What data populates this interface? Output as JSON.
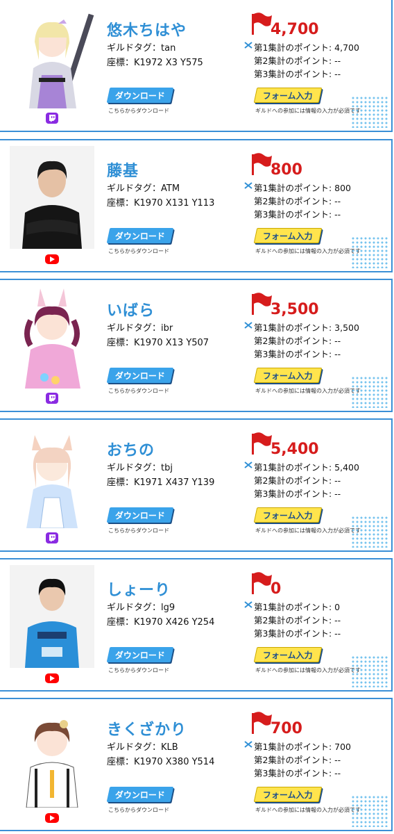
{
  "labels": {
    "download_button": "ダウンロード",
    "download_note": "こちらからダウンロード",
    "form_button": "フォーム入力",
    "form_note": "ギルドへの参加には情報の入力が必須です"
  },
  "colors": {
    "accent_blue": "#2f8fd5",
    "total_red": "#d61c1c",
    "form_yellow": "#ffe44d",
    "twitch_purple": "#8a2be2",
    "youtube_red": "#ff0000"
  },
  "players": [
    {
      "name": "悠木ちはや",
      "guild_tag": "ギルドタグ：tan",
      "coords": "座標：K1972 X3 Y575",
      "total": "4,700",
      "agg1": "第1集計のポイント: 4,700",
      "agg2": "第2集計のポイント: --",
      "agg3": "第3集計のポイント: --",
      "platform": "twitch-icon"
    },
    {
      "name": "藤基",
      "guild_tag": "ギルドタグ：ATM",
      "coords": "座標：K1970 X131 Y113",
      "total": "800",
      "agg1": "第1集計のポイント: 800",
      "agg2": "第2集計のポイント: --",
      "agg3": "第3集計のポイント: --",
      "platform": "youtube-icon"
    },
    {
      "name": "いばら",
      "guild_tag": "ギルドタグ：ibr",
      "coords": "座標：K1970 X13 Y507",
      "total": "3,500",
      "agg1": "第1集計のポイント: 3,500",
      "agg2": "第2集計のポイント: --",
      "agg3": "第3集計のポイント: --",
      "platform": "twitch-icon"
    },
    {
      "name": "おちの",
      "guild_tag": "ギルドタグ：tbj",
      "coords": "座標：K1971 X437 Y139",
      "total": "5,400",
      "agg1": "第1集計のポイント: 5,400",
      "agg2": "第2集計のポイント: --",
      "agg3": "第3集計のポイント: --",
      "platform": "twitch-icon"
    },
    {
      "name": "しょーり",
      "guild_tag": "ギルドタグ：lg9",
      "coords": "座標：K1970 X426 Y254",
      "total": "0",
      "agg1": "第1集計のポイント: 0",
      "agg2": "第2集計のポイント: --",
      "agg3": "第3集計のポイント: --",
      "platform": "youtube-icon"
    },
    {
      "name": "きくざかり",
      "guild_tag": "ギルドタグ：KLB",
      "coords": "座標：K1970 X380 Y514",
      "total": "700",
      "agg1": "第1集計のポイント: 700",
      "agg2": "第2集計のポイント: --",
      "agg3": "第3集計のポイント: --",
      "platform": "youtube-icon"
    }
  ]
}
